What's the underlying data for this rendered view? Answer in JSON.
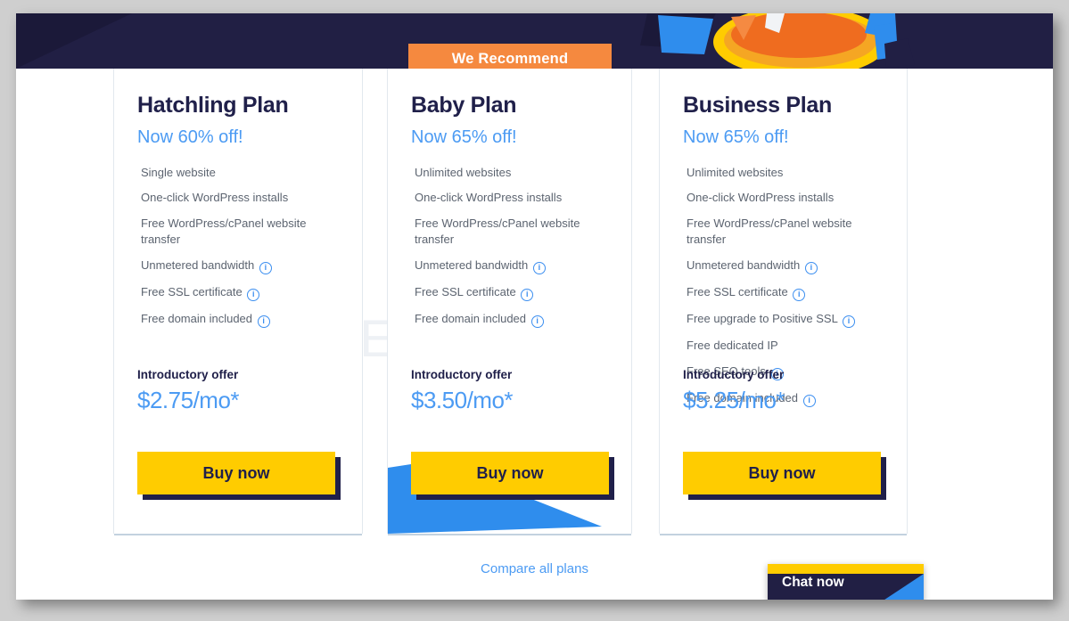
{
  "hero": {
    "background_color": "#211f44",
    "illustration_name": "gecko-mascot-illustration"
  },
  "badge": {
    "label": "We Recommend",
    "color": "#f5893f"
  },
  "watermark": {
    "text": "ORIDSITE.COM"
  },
  "colors": {
    "navy": "#20204a",
    "blue": "#4c9bf3",
    "yellow": "#ffcc00",
    "orange": "#f5893f",
    "feature_text": "#5c6470"
  },
  "plans": [
    {
      "title": "Hatchling Plan",
      "discount": "Now 60% off!",
      "features": [
        {
          "text": "Single website",
          "info": false
        },
        {
          "text": "One-click WordPress installs",
          "info": false
        },
        {
          "text": "Free WordPress/cPanel website transfer",
          "info": false
        },
        {
          "text": "Unmetered bandwidth",
          "info": true
        },
        {
          "text": "Free SSL certificate",
          "info": true
        },
        {
          "text": "Free domain included",
          "info": true
        }
      ],
      "offer_label": "Introductory offer",
      "price": "$2.75/mo*",
      "button_label": "Buy now",
      "recommended": false
    },
    {
      "title": "Baby Plan",
      "discount": "Now 65% off!",
      "features": [
        {
          "text": "Unlimited websites",
          "info": false
        },
        {
          "text": "One-click WordPress installs",
          "info": false
        },
        {
          "text": "Free WordPress/cPanel website transfer",
          "info": false
        },
        {
          "text": "Unmetered bandwidth",
          "info": true
        },
        {
          "text": "Free SSL certificate",
          "info": true
        },
        {
          "text": "Free domain included",
          "info": true
        }
      ],
      "offer_label": "Introductory offer",
      "price": "$3.50/mo*",
      "button_label": "Buy now",
      "recommended": true
    },
    {
      "title": "Business Plan",
      "discount": "Now 65% off!",
      "features": [
        {
          "text": "Unlimited websites",
          "info": false
        },
        {
          "text": "One-click WordPress installs",
          "info": false
        },
        {
          "text": "Free WordPress/cPanel website transfer",
          "info": false
        },
        {
          "text": "Unmetered bandwidth",
          "info": true
        },
        {
          "text": "Free SSL certificate",
          "info": true
        },
        {
          "text": "Free upgrade to Positive SSL",
          "info": true
        },
        {
          "text": "Free dedicated IP",
          "info": false
        },
        {
          "text": "Free SEO tools",
          "info": true
        },
        {
          "text": "Free domain included",
          "info": true
        }
      ],
      "offer_label": "Introductory offer",
      "price": "$5.25/mo*",
      "button_label": "Buy now",
      "recommended": false
    }
  ],
  "compare_link": "Compare all plans",
  "chat": {
    "label": "Chat now"
  }
}
